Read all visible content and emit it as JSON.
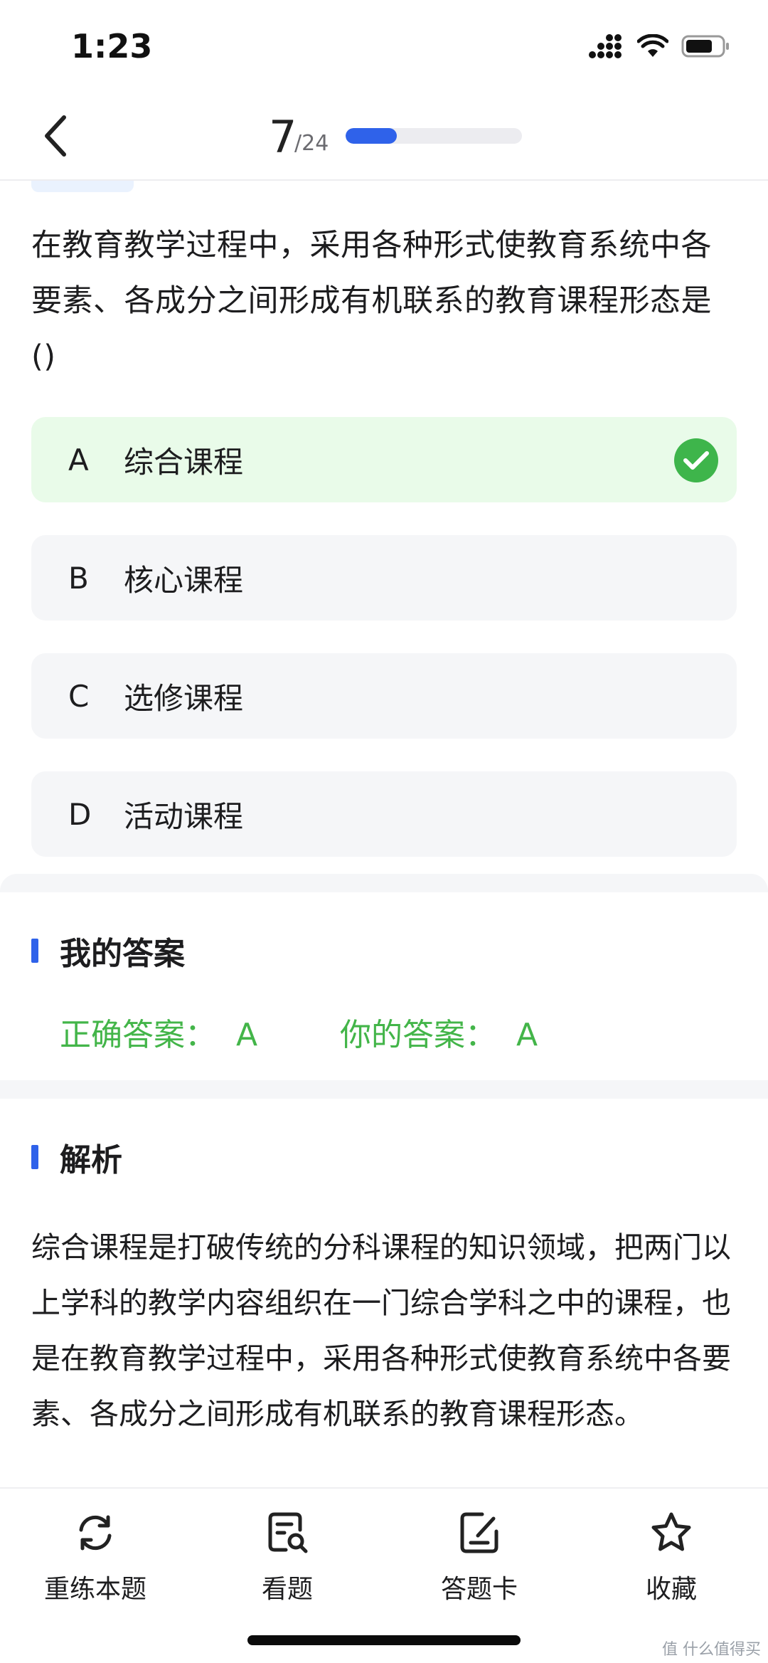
{
  "status_bar": {
    "time": "1:23"
  },
  "header": {
    "current": "7",
    "total": "/24",
    "progress": 0.292
  },
  "question": {
    "text": "在教育教学过程中，采用各种形式使教育系统中各要素、各成分之间形成有机联系的教育课程形态是()",
    "options": [
      {
        "letter": "A",
        "text": "综合课程",
        "state": "correct"
      },
      {
        "letter": "B",
        "text": "核心课程",
        "state": "normal"
      },
      {
        "letter": "C",
        "text": "选修课程",
        "state": "normal"
      },
      {
        "letter": "D",
        "text": "活动课程",
        "state": "normal"
      }
    ]
  },
  "my_answer": {
    "title": "我的答案",
    "correct_label": "正确答案：",
    "correct_value": "A",
    "yours_label": "你的答案：",
    "yours_value": "A"
  },
  "analysis": {
    "title": "解析",
    "text": "综合课程是打破传统的分科课程的知识领域，把两门以上学科的教学内容组织在一门综合学科之中的课程，也是在教育教学过程中，采用各种形式使教育系统中各要素、各成分之间形成有机联系的教育课程形态。"
  },
  "toolbar": {
    "retry_label": "重练本题",
    "view_label": "看题",
    "card_label": "答题卡",
    "favorite_label": "收藏"
  },
  "watermark": "值 什么值得买",
  "colors": {
    "accent": "#2f62ea",
    "correct": "#43b549",
    "correct_bg": "#e9fbe9"
  }
}
